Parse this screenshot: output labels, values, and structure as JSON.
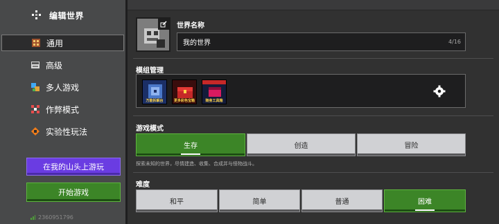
{
  "sidebar": {
    "title": "编辑世界",
    "items": [
      {
        "label": "通用",
        "icon": "general-icon",
        "selected": true
      },
      {
        "label": "高级",
        "icon": "advanced-icon",
        "selected": false
      },
      {
        "label": "多人游戏",
        "icon": "multiplayer-icon",
        "selected": false
      },
      {
        "label": "作弊模式",
        "icon": "cheats-icon",
        "selected": false
      },
      {
        "label": "实验性玩法",
        "icon": "experiments-icon",
        "selected": false
      }
    ],
    "realm_button": "在我的山头上游玩",
    "play_button": "开始游戏",
    "version": "2360951796"
  },
  "world": {
    "name_label": "世界名称",
    "name_value": "我的世界",
    "name_count": "4/16"
  },
  "addons": {
    "label": "模组管理",
    "packs": [
      {
        "caption": "万能拆解台",
        "icon": "pack-cube-icon"
      },
      {
        "caption": "更多彩色宝箱",
        "icon": "pack-chest-icon"
      },
      {
        "caption": "随身工具箱",
        "icon": "pack-toolbox-icon"
      }
    ]
  },
  "gamemode": {
    "label": "游戏模式",
    "options": [
      "生存",
      "创造",
      "冒险"
    ],
    "selected": "生存",
    "description": "探索未知的世界，尽情建造、收集、合成并与怪物战斗。"
  },
  "difficulty": {
    "label": "难度",
    "options": [
      "和平",
      "简单",
      "普通",
      "困难"
    ],
    "selected": "困难"
  },
  "colors": {
    "accent_green": "#3c8527",
    "accent_purple": "#6a3ce2",
    "panel_bg": "#313131",
    "sidebar_bg": "#48494a"
  }
}
